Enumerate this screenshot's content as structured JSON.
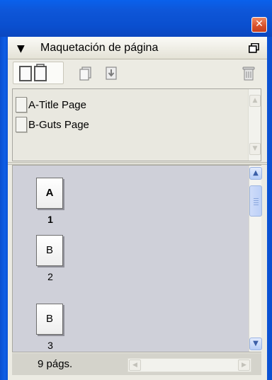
{
  "window": {
    "close_glyph": "✕"
  },
  "panel": {
    "collapse_glyph": "▼",
    "title": "Maquetación de página",
    "menu_icon": "panel-menu-icon"
  },
  "toolbar": {
    "icons": [
      "pages-view-icon",
      "new-page-icon",
      "load-masters-icon",
      "delete-page-icon"
    ]
  },
  "masters": {
    "items": [
      {
        "label": "A-Title Page"
      },
      {
        "label": "B-Guts Page"
      }
    ],
    "scroll_up_glyph": "▲",
    "scroll_down_glyph": "▼"
  },
  "pages": {
    "items": [
      {
        "letter": "A",
        "number": "1",
        "selected": true
      },
      {
        "letter": "B",
        "number": "2",
        "selected": false
      },
      {
        "letter": "B",
        "number": "3",
        "selected": false
      }
    ],
    "scroll_up_glyph": "▲",
    "scroll_down_glyph": "▼"
  },
  "status": {
    "page_count": "9 págs.",
    "scroll_left_glyph": "◀",
    "scroll_right_glyph": "▶"
  },
  "colors": {
    "titlebar": "#0a58e0",
    "pages_bg": "#cfd0d9",
    "panel_bg": "#ecebe3",
    "close_button": "#d8502a"
  }
}
